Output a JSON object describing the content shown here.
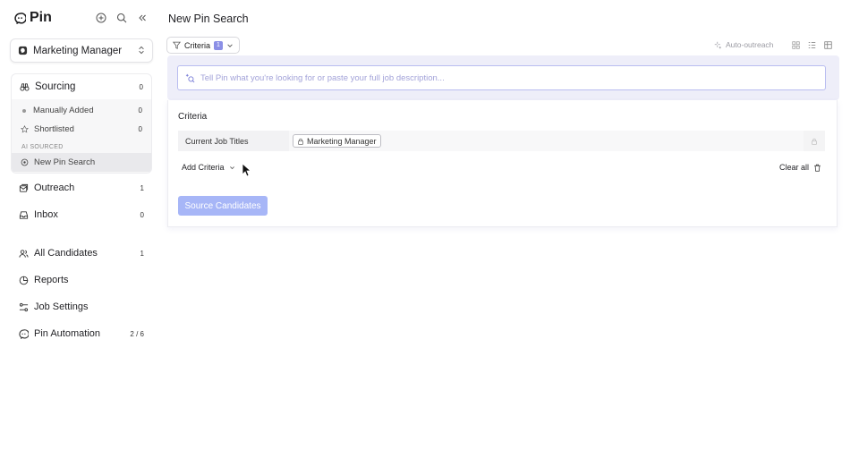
{
  "app": {
    "name": "Pin"
  },
  "sidebar": {
    "job": {
      "name": "Marketing Manager"
    },
    "sourcing": {
      "label": "Sourcing",
      "count": "0",
      "items": [
        {
          "label": "Manually Added",
          "count": "0",
          "icon": "dot-icon"
        },
        {
          "label": "Shortlisted",
          "count": "0",
          "icon": "star-icon"
        }
      ],
      "ai_section_label": "AI SOURCED",
      "ai_items": [
        {
          "label": "New Pin Search",
          "icon": "target-icon"
        }
      ]
    },
    "nav": [
      {
        "label": "Outreach",
        "count": "1",
        "icon": "outreach-icon"
      },
      {
        "label": "Inbox",
        "count": "0",
        "icon": "inbox-icon"
      },
      {
        "label": "All Candidates",
        "count": "1",
        "icon": "users-icon"
      },
      {
        "label": "Reports",
        "count": "",
        "icon": "pie-chart-icon"
      },
      {
        "label": "Job Settings",
        "count": "",
        "icon": "settings-sliders-icon"
      },
      {
        "label": "Pin Automation",
        "count": "2 / 6",
        "icon": "pin-logo-icon"
      }
    ]
  },
  "main": {
    "title": "New Pin Search",
    "criteria_button": {
      "label": "Criteria",
      "badge": "1"
    },
    "auto_outreach_label": "Auto-outreach",
    "prompt": {
      "placeholder": "Tell Pin what you're looking for or paste your full job description..."
    },
    "criteria": {
      "title": "Criteria",
      "rows": [
        {
          "key": "Current Job Titles",
          "values": [
            "Marketing Manager"
          ]
        }
      ],
      "add_label": "Add Criteria",
      "clear_label": "Clear all"
    },
    "source_button": "Source Candidates"
  },
  "colors": {
    "accent": "#8b8fe6",
    "source_button": "#a7b6f7",
    "prompt_border": "#b9bdf0",
    "prompt_background": "#eeeef9"
  }
}
